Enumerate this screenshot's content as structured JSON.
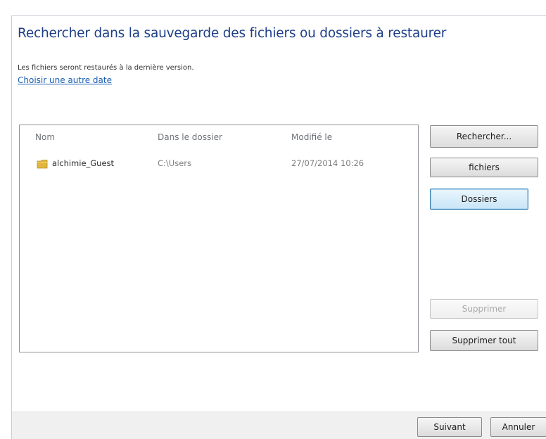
{
  "dialog": {
    "title": "Rechercher dans la sauvegarde des fichiers ou dossiers à restaurer",
    "info": "Les fichiers seront restaurés à la dernière version.",
    "link": "Choisir une autre date"
  },
  "table": {
    "headers": [
      "Nom",
      "Dans le dossier",
      "Modifié le"
    ],
    "rows": [
      {
        "name": "alchimie_Guest",
        "folder": "C:\\Users",
        "modified": "27/07/2014 10:26",
        "icon": "folder-icon"
      }
    ]
  },
  "side_buttons": {
    "search": "Rechercher...",
    "files": "fichiers",
    "folders": "Dossiers",
    "remove": "Supprimer",
    "remove_all": "Supprimer tout"
  },
  "footer": {
    "next": "Suivant",
    "cancel": "Annuler"
  },
  "colors": {
    "title": "#1e3f87",
    "link": "#1a5fb4",
    "folder_icon": "#e0b640"
  }
}
